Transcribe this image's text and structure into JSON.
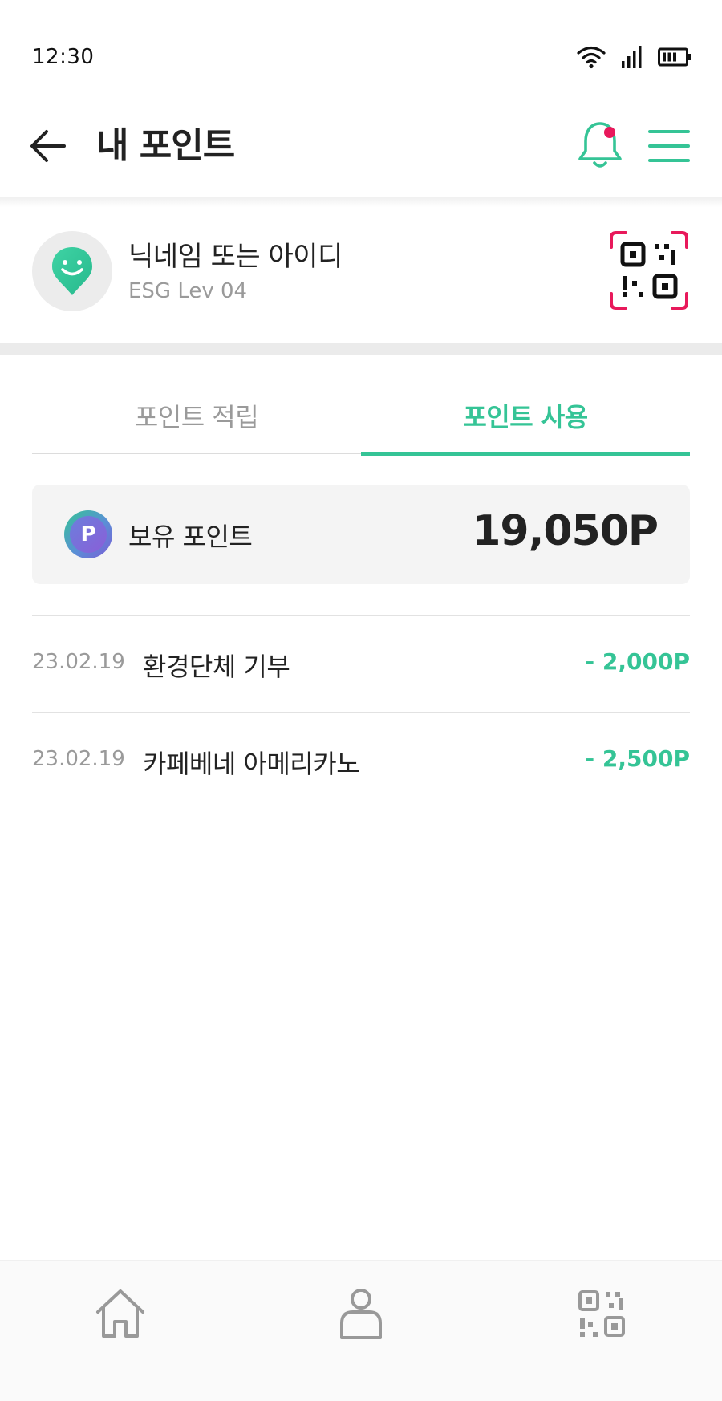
{
  "status_bar": {
    "time": "12:30"
  },
  "header": {
    "title": "내 포인트"
  },
  "profile": {
    "nickname": "닉네임 또는 아이디",
    "level": "ESG Lev 04"
  },
  "tabs": [
    {
      "label": "포인트 적립",
      "active": false
    },
    {
      "label": "포인트 사용",
      "active": true
    }
  ],
  "points": {
    "label": "보유 포인트",
    "badge": "P",
    "value": "19,050P"
  },
  "history": [
    {
      "date": "23.02.19",
      "title": "환경단체 기부",
      "amount": "- 2,000P"
    },
    {
      "date": "23.02.19",
      "title": "카페베네 아메리카노",
      "amount": "- 2,500P"
    }
  ],
  "colors": {
    "accent": "#35c496",
    "alert": "#e8195b",
    "text": "#222222",
    "muted": "#9a9a9a"
  }
}
